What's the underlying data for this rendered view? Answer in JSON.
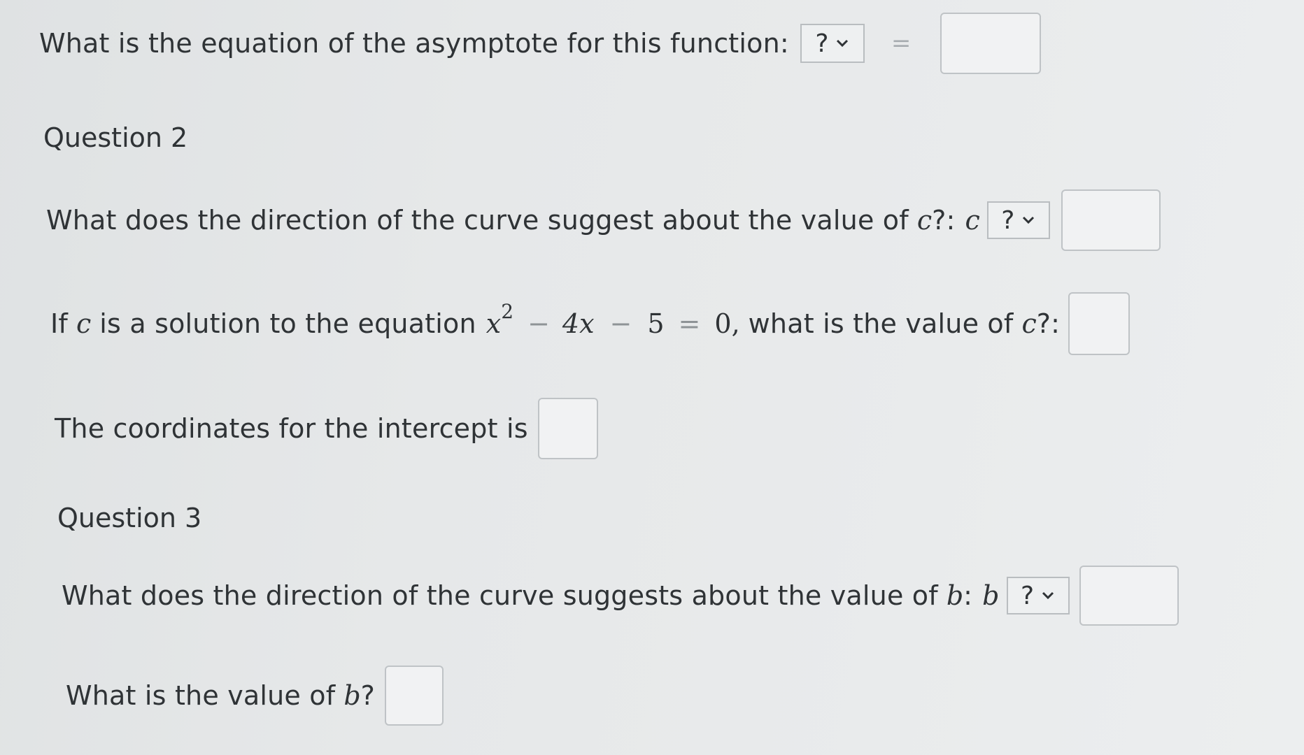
{
  "q1": {
    "prompt": "What is the equation of the asymptote for this function:",
    "dropdown": {
      "selected": "?"
    },
    "equals": "=",
    "answer_value": ""
  },
  "q2": {
    "heading": "Question 2",
    "direction": {
      "prompt": "What does the direction of the curve suggest about the value of",
      "var": "c",
      "suffix": "?:",
      "var_after": "c",
      "dropdown": {
        "selected": "?"
      },
      "answer_value": ""
    },
    "solution": {
      "prefix": "If",
      "var": "c",
      "middle": "is a solution to the equation",
      "eq_x": "x",
      "eq_exp": "2",
      "eq_minus1": "−",
      "eq_term": "4x",
      "eq_minus2": "−",
      "eq_const": "5",
      "eq_equals": "=",
      "eq_rhs": "0,",
      "question": "what is the value of",
      "var2": "c",
      "suffix": "?:",
      "answer_value": ""
    },
    "intercept": {
      "prompt": "The coordinates for the intercept is",
      "answer_value": ""
    }
  },
  "q3": {
    "heading": "Question 3",
    "direction": {
      "prompt": "What does the direction of the curve suggests about the value of",
      "var": "b",
      "suffix": ":",
      "var_after": "b",
      "dropdown": {
        "selected": "?"
      },
      "answer_value": ""
    },
    "value": {
      "prompt": "What is the value of",
      "var": "b",
      "suffix": "?",
      "answer_value": ""
    }
  },
  "icons": {
    "dropdown": "chevron-down-icon"
  }
}
